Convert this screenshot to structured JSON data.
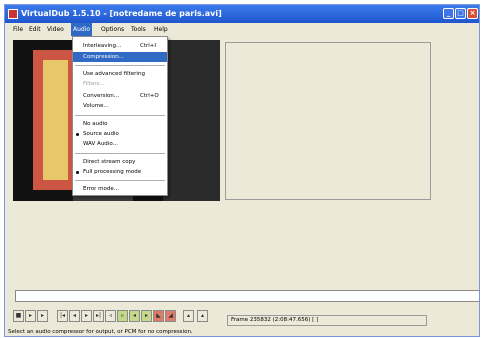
{
  "window": {
    "title": "VirtualDub 1.5.10 - [notredame de paris.avi]"
  },
  "menubar": [
    {
      "label": "File"
    },
    {
      "label": "Edit"
    },
    {
      "label": "Video"
    },
    {
      "label": "Audio"
    },
    {
      "label": "Options"
    },
    {
      "label": "Tools"
    },
    {
      "label": "Help"
    }
  ],
  "audio_menu": [
    {
      "label": "Interleaving...",
      "shortcut": "Ctrl+I"
    },
    {
      "label": "Compression...",
      "shortcut": ""
    },
    {
      "label": "Use advanced filtering",
      "shortcut": ""
    },
    {
      "label": "Filters...",
      "shortcut": ""
    },
    {
      "label": "Conversion...",
      "shortcut": "Ctrl+O"
    },
    {
      "label": "Volume...",
      "shortcut": ""
    },
    {
      "label": "No audio",
      "shortcut": ""
    },
    {
      "label": "Source audio",
      "shortcut": ""
    },
    {
      "label": "WAV Audio...",
      "shortcut": ""
    },
    {
      "label": "Direct stream copy",
      "shortcut": ""
    },
    {
      "label": "Full processing mode",
      "shortcut": ""
    },
    {
      "label": "Error mode...",
      "shortcut": ""
    }
  ],
  "frame_readout": "Frame 235832 (2:08:47.656) [ ]",
  "status_bar": "Select an audio compressor for output, or PCM for no compression.",
  "colors": {
    "highlight": "#316ac5",
    "titlebar": "#1f56cf",
    "close": "#d65133"
  }
}
